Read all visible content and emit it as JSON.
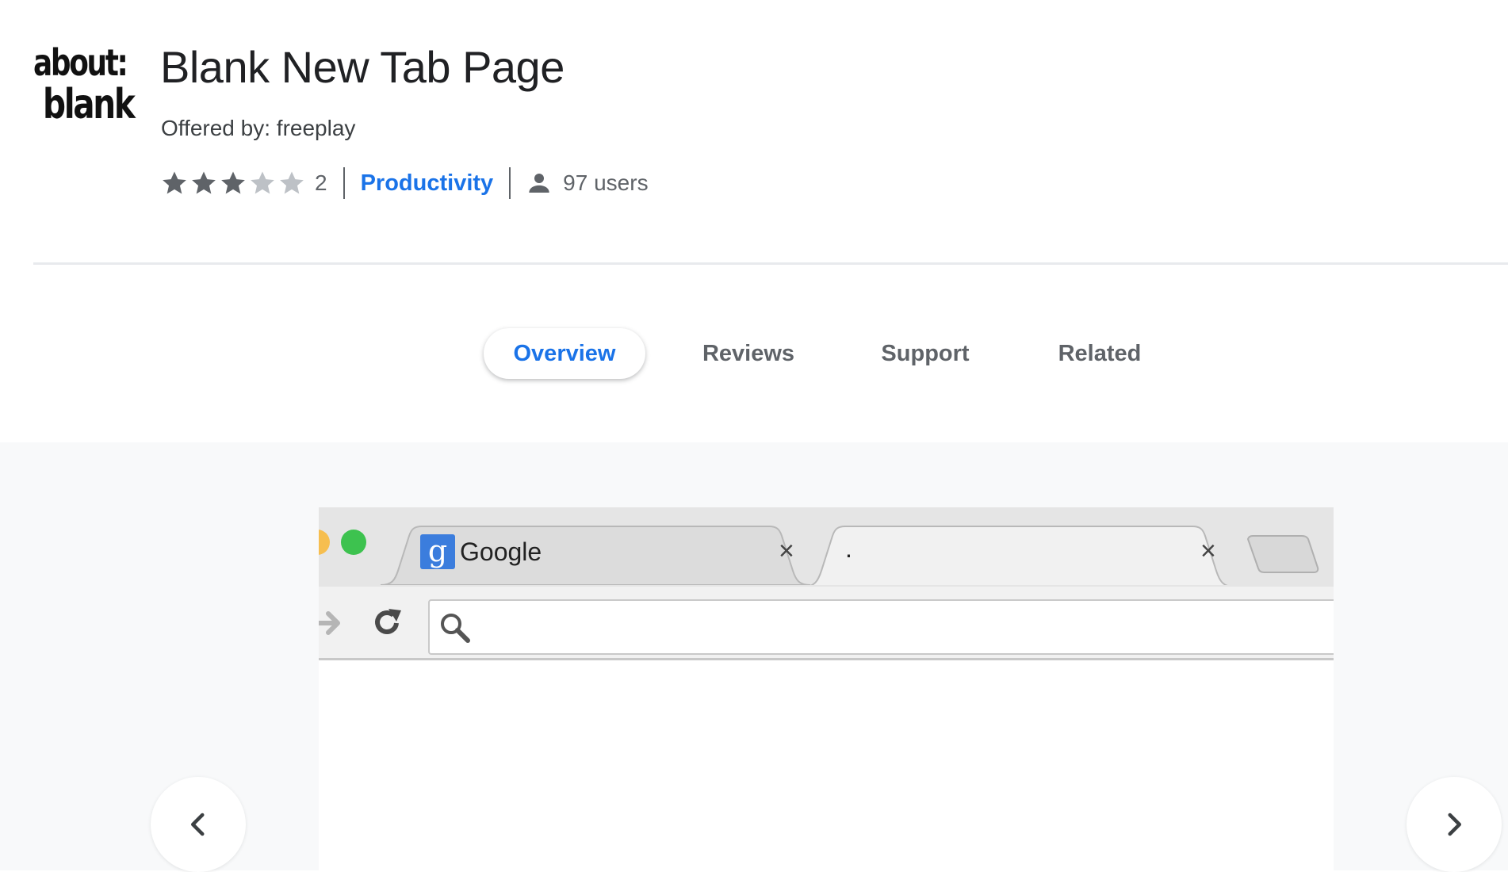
{
  "logo": {
    "line1": "about:",
    "line2": "blank"
  },
  "extension": {
    "title": "Blank New Tab Page",
    "offered_by": "Offered by: freeplay",
    "rating": 3,
    "rating_max": 5,
    "rating_count": "2",
    "category": "Productivity",
    "users": "97 users"
  },
  "tabs": [
    {
      "label": "Overview",
      "active": true
    },
    {
      "label": "Reviews",
      "active": false
    },
    {
      "label": "Support",
      "active": false
    },
    {
      "label": "Related",
      "active": false
    }
  ],
  "screenshot": {
    "tab1_title": "Google",
    "tab2_title": ".",
    "close_glyph": "×"
  },
  "colors": {
    "accent": "#1a73e8",
    "text_secondary": "#5f6368",
    "gallery_bg": "#f8f9fa"
  },
  "icons": [
    "star-icon",
    "user-icon",
    "chevron-left-icon",
    "chevron-right-icon",
    "reload-icon",
    "search-icon",
    "forward-icon",
    "google-icon"
  ]
}
